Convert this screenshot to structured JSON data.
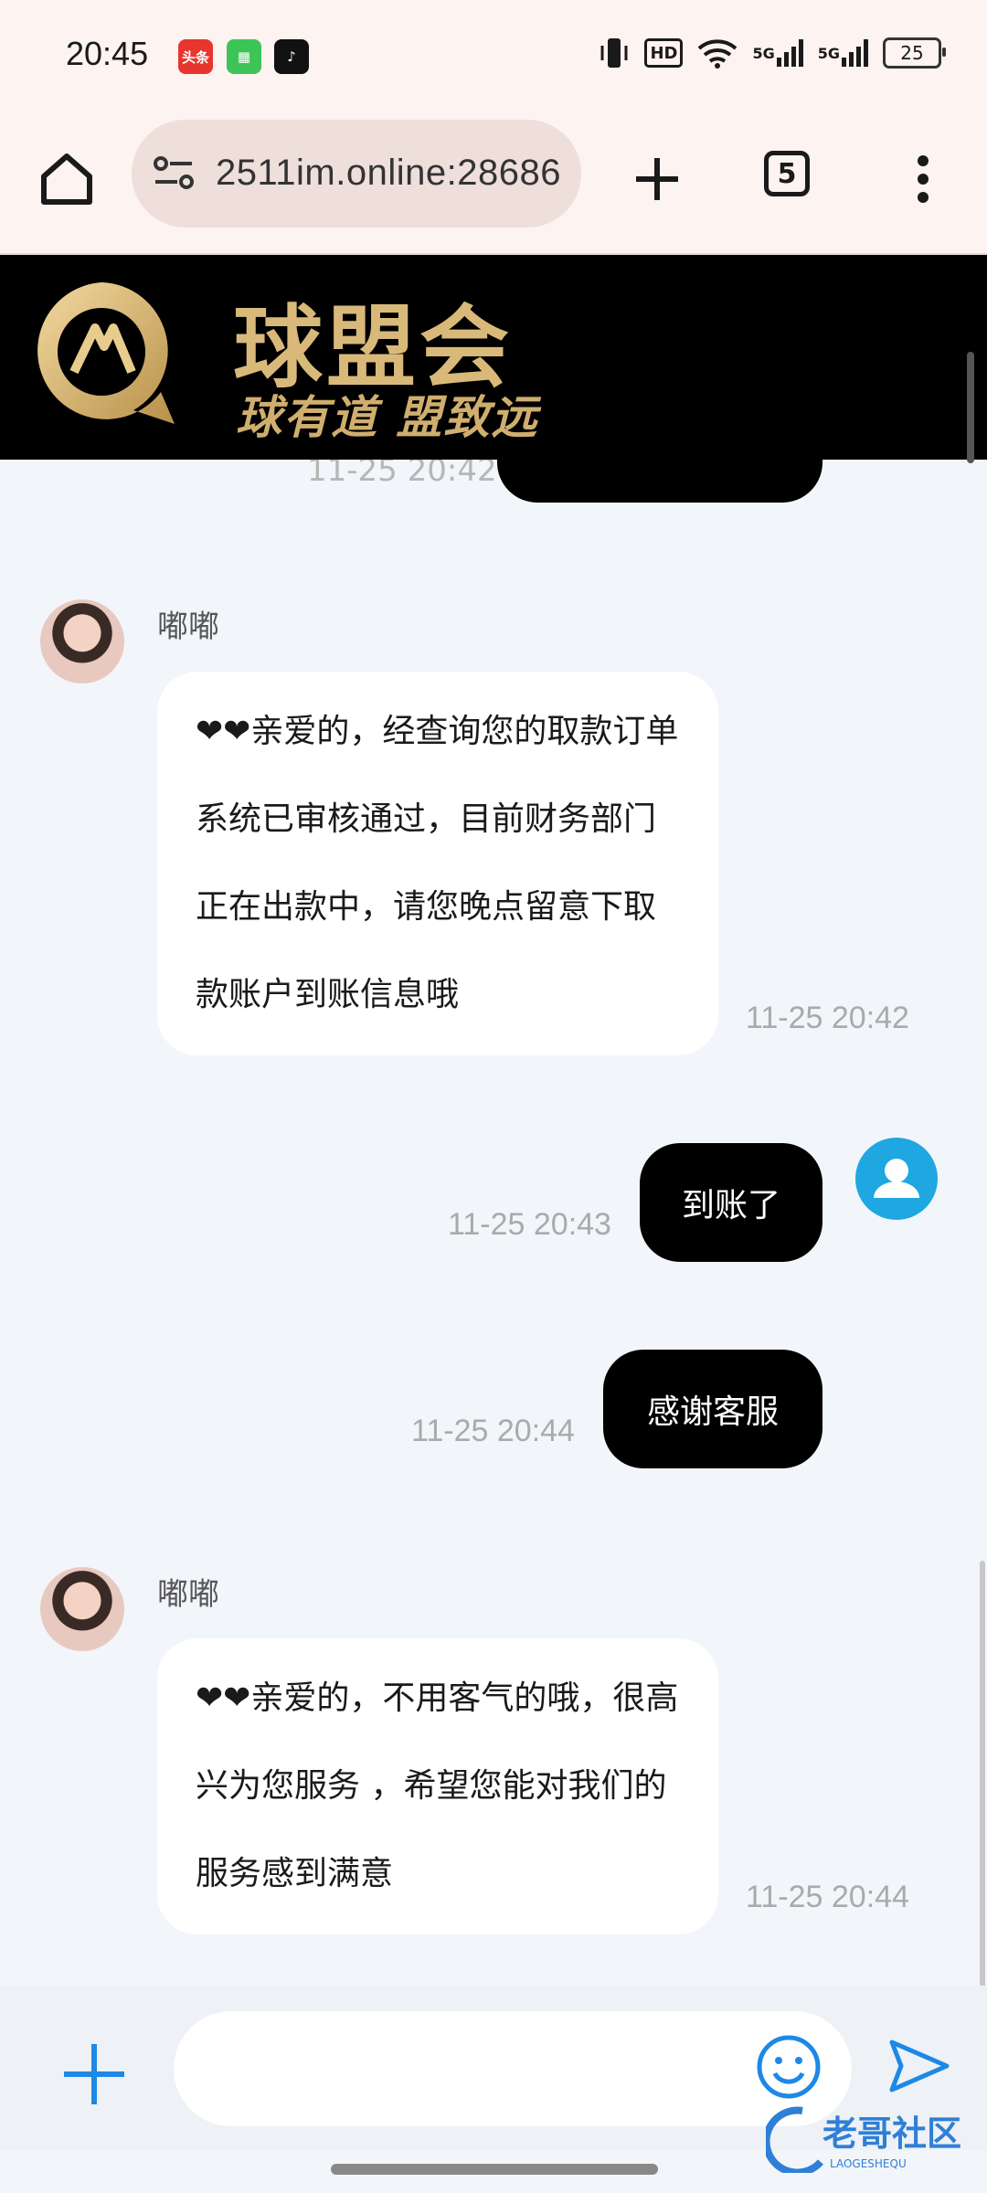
{
  "status_bar": {
    "time": "20:45",
    "apps": [
      "头条",
      "",
      ""
    ],
    "network": [
      "5G",
      "5G"
    ],
    "hd_label": "HD",
    "battery": "25"
  },
  "browser": {
    "url": "2511im.online:28686",
    "tab_count": "5"
  },
  "banner": {
    "title": "球盟会",
    "slogan": "球有道 盟致远"
  },
  "chat": {
    "previous_time": "11-25 20:42",
    "messages": [
      {
        "sender": "嘟嘟",
        "text": "❤❤亲爱的，经查询您的取款订单系统已审核通过，目前财务部门正在出款中，请您晚点留意下取款账户到账信息哦",
        "time": "11-25 20:42"
      },
      {
        "text": "到账了",
        "time": "11-25 20:43"
      },
      {
        "text": "感谢客服",
        "time": "11-25 20:44"
      },
      {
        "sender": "嘟嘟",
        "text": "❤❤亲爱的，不用客气的哦，很高兴为您服务 ，希望您能对我们的服务感到满意",
        "time": "11-25 20:44"
      }
    ]
  },
  "composer": {
    "placeholder": ""
  },
  "watermark": {
    "text": "老哥社区",
    "subtext": "LAOGESHEQU"
  },
  "colors": {
    "browser_bg": "#fdf3f0",
    "banner_gold": "#d9b97a",
    "accent_blue": "#1ea7e0",
    "chat_bg": "#f2f5fa"
  }
}
